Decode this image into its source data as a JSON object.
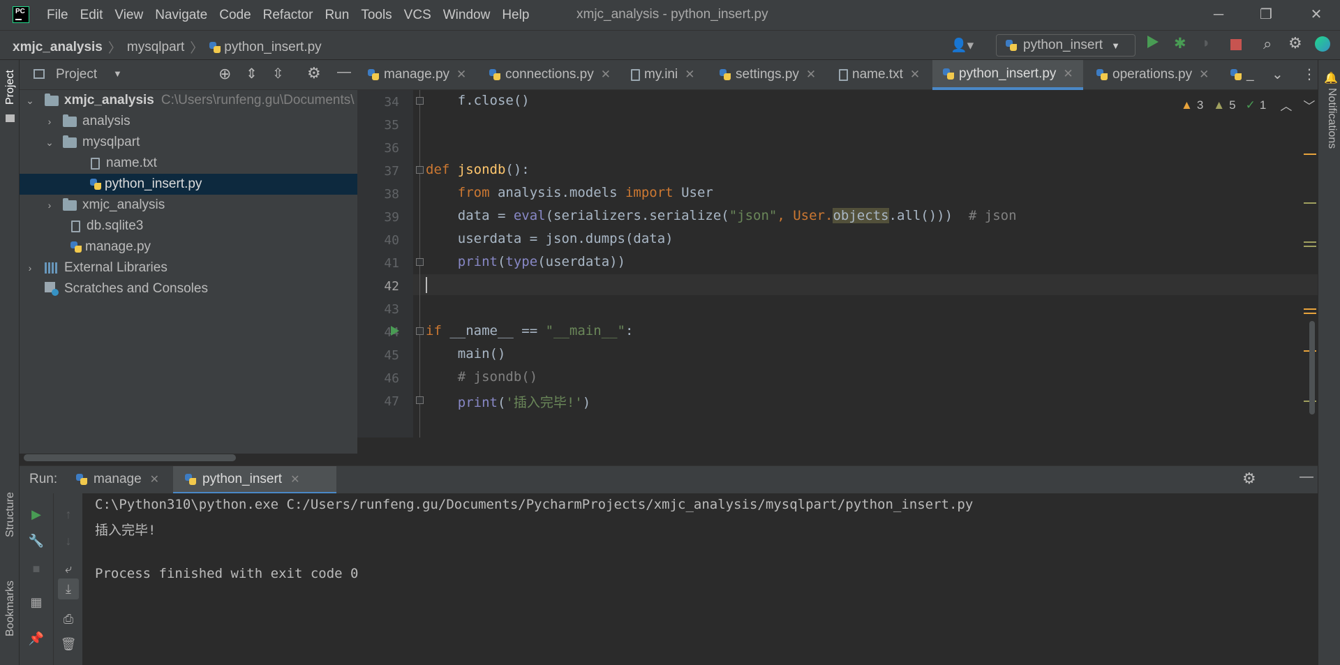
{
  "window": {
    "title": "xmjc_analysis - python_insert.py",
    "menu": [
      "File",
      "Edit",
      "View",
      "Navigate",
      "Code",
      "Refactor",
      "Run",
      "Tools",
      "VCS",
      "Window",
      "Help"
    ]
  },
  "breadcrumb": {
    "project": "xmjc_analysis",
    "folder": "mysqlpart",
    "file": "python_insert.py"
  },
  "run_config": {
    "name": "python_insert"
  },
  "left_strip": {
    "project": "Project",
    "structure": "Structure",
    "bookmarks": "Bookmarks"
  },
  "right_strip": {
    "notifications": "Notifications"
  },
  "project_panel": {
    "title": "Project",
    "tree": [
      {
        "label": "xmjc_analysis",
        "hint": "C:\\Users\\runfeng.gu\\Documents\\",
        "type": "folder",
        "expanded": true
      },
      {
        "label": "analysis",
        "type": "module",
        "expanded": false
      },
      {
        "label": "mysqlpart",
        "type": "folder",
        "expanded": true
      },
      {
        "label": "name.txt",
        "type": "text"
      },
      {
        "label": "python_insert.py",
        "type": "python",
        "selected": true
      },
      {
        "label": "xmjc_analysis",
        "type": "module",
        "expanded": false
      },
      {
        "label": "db.sqlite3",
        "type": "text"
      },
      {
        "label": "manage.py",
        "type": "python"
      },
      {
        "label": "External Libraries",
        "type": "library",
        "expanded": false
      },
      {
        "label": "Scratches and Consoles",
        "type": "scratch"
      }
    ]
  },
  "tabs": [
    {
      "label": "manage.py",
      "icon": "python-file-icon"
    },
    {
      "label": "connections.py",
      "icon": "python-file-icon"
    },
    {
      "label": "my.ini",
      "icon": "text-file-icon"
    },
    {
      "label": "settings.py",
      "icon": "python-file-icon"
    },
    {
      "label": "name.txt",
      "icon": "text-file-icon"
    },
    {
      "label": "python_insert.py",
      "icon": "python-file-icon",
      "active": true
    },
    {
      "label": "operations.py",
      "icon": "python-file-icon"
    },
    {
      "label": "_",
      "icon": "python-file-icon"
    }
  ],
  "inspections": {
    "warnings": "3",
    "weak_warnings": "5",
    "typos": "1"
  },
  "code": {
    "line_numbers": [
      "34",
      "35",
      "36",
      "37",
      "38",
      "39",
      "40",
      "41",
      "42",
      "43",
      "44",
      "45",
      "46",
      "47"
    ],
    "l34": "    f.close()",
    "l37_def": "def ",
    "l37_fn": "jsondb",
    "l37_rest": "():",
    "l38_from": "    from",
    "l38_mid": " analysis.models ",
    "l38_import": "import",
    "l38_rest": " User",
    "l39_a": "    data = ",
    "l39_eval": "eval",
    "l39_b": "(serializers.serialize(",
    "l39_str": "\"json\"",
    "l39_c": ", User.",
    "l39_hl": "objects",
    "l39_d": ".all()))  ",
    "l39_cm": "# json",
    "l40": "    userdata = json.dumps(data)",
    "l41_pre": "    ",
    "l41_print": "print",
    "l41_b": "(",
    "l41_type": "type",
    "l41_c": "(userdata))",
    "l44_if": "if",
    "l44_b": " __name__ == ",
    "l44_str": "\"__main__\"",
    "l44_c": ":",
    "l45": "    main()",
    "l46": "    # jsondb()",
    "l47_pre": "    ",
    "l47_print": "print",
    "l47_b": "(",
    "l47_str": "'插入完毕!'",
    "l47_c": ")"
  },
  "run_panel": {
    "label": "Run:",
    "tabs": [
      {
        "label": "manage"
      },
      {
        "label": "python_insert",
        "active": true
      }
    ],
    "output": [
      "C:\\Python310\\python.exe C:/Users/runfeng.gu/Documents/PycharmProjects/xmjc_analysis/mysqlpart/python_insert.py",
      "插入完毕!",
      "",
      "Process finished with exit code 0"
    ]
  },
  "colors": {
    "accent": "#4a88c7",
    "run_green": "#499c54",
    "stop_red": "#c75450",
    "selection": "#0d293e"
  }
}
